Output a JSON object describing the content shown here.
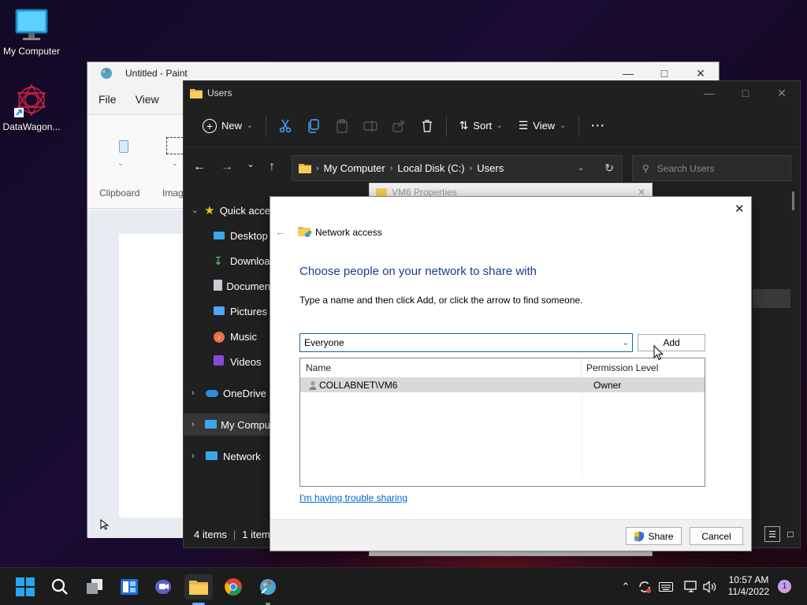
{
  "desktop": {
    "icons": [
      {
        "label": "My Computer"
      },
      {
        "label": "DataWagon..."
      }
    ]
  },
  "paint": {
    "title": "Untitled - Paint",
    "menu": [
      "File",
      "View"
    ],
    "ribbon": {
      "clipboard": "Clipboard",
      "image": "Imag"
    }
  },
  "explorer": {
    "title": "Users",
    "toolbar": {
      "new": "New",
      "sort": "Sort",
      "view": "View"
    },
    "breadcrumb": [
      "My Computer",
      "Local Disk (C:)",
      "Users"
    ],
    "search_placeholder": "Search Users",
    "nav": {
      "quick_access": "Quick acce",
      "desktop": "Desktop",
      "downloads": "Downloa",
      "documents": "Documen",
      "pictures": "Pictures",
      "music": "Music",
      "videos": "Videos",
      "onedrive": "OneDrive",
      "my_computer": "My Compu",
      "network": "Network"
    },
    "status": {
      "items": "4 items",
      "selected": "1 item"
    }
  },
  "properties": {
    "title": "VM6 Properties"
  },
  "dialog": {
    "title": "Network access",
    "heading": "Choose people on your network to share with",
    "instruction": "Type a name and then click Add, or click the arrow to find someone.",
    "combo_value": "Everyone",
    "add_label": "Add",
    "columns": {
      "name": "Name",
      "permission": "Permission Level"
    },
    "rows": [
      {
        "name": "COLLABNET\\VM6",
        "permission": "Owner"
      }
    ],
    "trouble_link": "I'm having trouble sharing",
    "share_label": "Share",
    "cancel_label": "Cancel"
  },
  "taskbar": {
    "clock_time": "10:57 AM",
    "clock_date": "11/4/2022",
    "notification_count": "1"
  },
  "colors": {
    "accent": "#0078d4",
    "dialog_heading": "#1e3a8a",
    "link": "#0066cc",
    "explorer_bg": "#202020"
  }
}
